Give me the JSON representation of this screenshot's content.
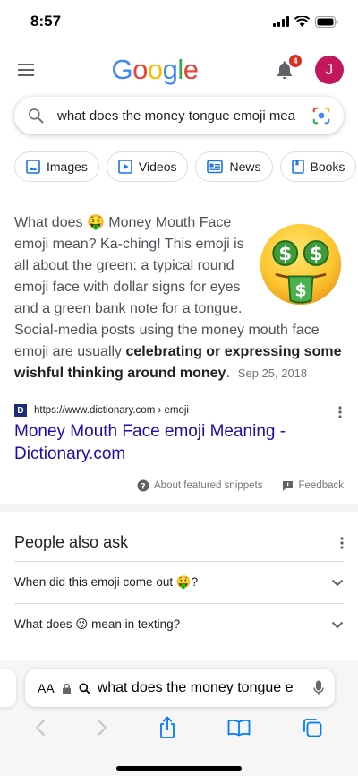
{
  "status": {
    "time": "8:57"
  },
  "header": {
    "logo_letters": [
      {
        "char": "G",
        "color": "#4285F4"
      },
      {
        "char": "o",
        "color": "#EA4335"
      },
      {
        "char": "o",
        "color": "#FBBC05"
      },
      {
        "char": "g",
        "color": "#4285F4"
      },
      {
        "char": "l",
        "color": "#34A853"
      },
      {
        "char": "e",
        "color": "#EA4335"
      }
    ],
    "notification_count": "4",
    "avatar_initial": "J"
  },
  "search": {
    "query": "what does the money tongue emoji mea"
  },
  "chips": [
    {
      "label": "Images",
      "icon": "image-icon"
    },
    {
      "label": "Videos",
      "icon": "play-icon"
    },
    {
      "label": "News",
      "icon": "news-icon"
    },
    {
      "label": "Books",
      "icon": "book-icon"
    },
    {
      "label": "",
      "icon": "tag-icon"
    }
  ],
  "snippet": {
    "text_before_emoji": "What does ",
    "inline_emoji": "🤑",
    "text_main": " Money Mouth Face emoji mean? Ka-ching! This emoji is all about the green: a typical round emoji face with dollar signs for eyes and a green bank note for a tongue. Social-media posts using the money mouth face emoji are usually ",
    "text_bold": "celebrating or expressing some wishful thinking around money",
    "text_end": ".",
    "date": "Sep 25, 2018",
    "emoji_image": "money-mouth-face-emoji"
  },
  "result": {
    "favicon_letter": "D",
    "url": "https://www.dictionary.com › emoji",
    "title": "Money Mouth Face emoji Meaning - Dictionary.com"
  },
  "snippet_footer": {
    "about_label": "About featured snippets",
    "feedback_label": "Feedback"
  },
  "people_also_ask": {
    "title": "People also ask",
    "questions": [
      "When did this emoji come out 🤑?",
      "What does 😜 mean in texting?"
    ]
  },
  "browser": {
    "aa_label": "AA",
    "address": "what does the money tongue e"
  },
  "colors": {
    "link": "#1a0dab",
    "badge": "#d93025",
    "avatar": "#c2185b",
    "ios_blue": "#007aff"
  }
}
